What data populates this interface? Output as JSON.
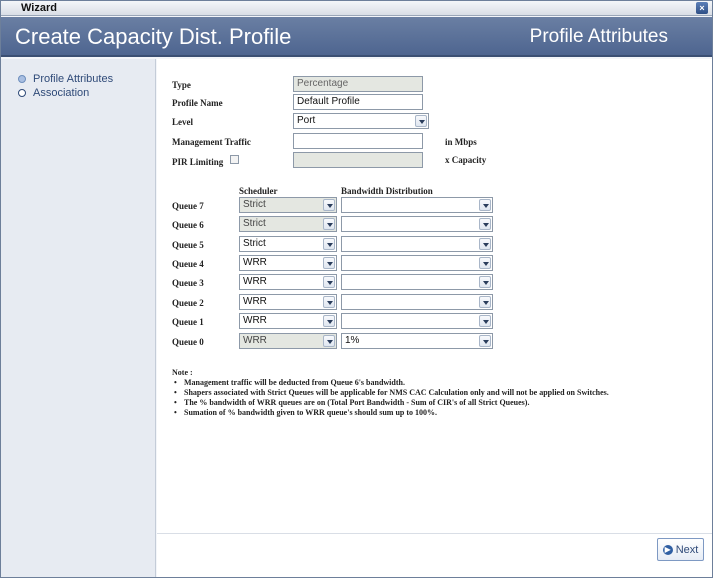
{
  "window": {
    "title": "Wizard",
    "close_glyph": "×"
  },
  "banner": {
    "title": "Create Capacity Dist. Profile",
    "step_title": "Profile Attributes"
  },
  "sidebar": {
    "items": [
      {
        "label": "Profile Attributes",
        "active": true
      },
      {
        "label": "Association",
        "active": false
      }
    ]
  },
  "form": {
    "type": {
      "label": "Type",
      "value": "Percentage"
    },
    "profile_name": {
      "label": "Profile Name",
      "value": "Default Profile"
    },
    "level": {
      "label": "Level",
      "value": "Port"
    },
    "management_traffic": {
      "label": "Management Traffic",
      "value": "",
      "unit": "in Mbps"
    },
    "pir_limiting": {
      "label": "PIR Limiting",
      "checked": false,
      "value": "",
      "unit": "x Capacity"
    }
  },
  "queues": {
    "header_scheduler": "Scheduler",
    "header_bandwidth": "Bandwidth Distribution",
    "rows": [
      {
        "label": "Queue 7",
        "scheduler": "Strict",
        "bandwidth": ""
      },
      {
        "label": "Queue 6",
        "scheduler": "Strict",
        "bandwidth": ""
      },
      {
        "label": "Queue 5",
        "scheduler": "Strict",
        "bandwidth": ""
      },
      {
        "label": "Queue 4",
        "scheduler": "WRR",
        "bandwidth": ""
      },
      {
        "label": "Queue 3",
        "scheduler": "WRR",
        "bandwidth": ""
      },
      {
        "label": "Queue 2",
        "scheduler": "WRR",
        "bandwidth": ""
      },
      {
        "label": "Queue 1",
        "scheduler": "WRR",
        "bandwidth": ""
      },
      {
        "label": "Queue 0",
        "scheduler": "WRR",
        "bandwidth": "1%"
      }
    ]
  },
  "notes": {
    "title": "Note :",
    "items": [
      "Management traffic will be deducted from Queue 6's bandwidth.",
      "Shapers associated with Strict Queues will be applicable for NMS CAC Calculation only and will not be applied on Switches.",
      "The % bandwidth of WRR queues are on (Total Port Bandwidth - Sum of CIR's of all Strict Queues).",
      "Sumation of % bandwidth given to WRR queue's should sum up to 100%."
    ]
  },
  "footer": {
    "next_label": "Next"
  },
  "colors": {
    "banner": "#5a6f97",
    "sidebar": "#e7ebf2",
    "accent": "#2f4a78"
  }
}
